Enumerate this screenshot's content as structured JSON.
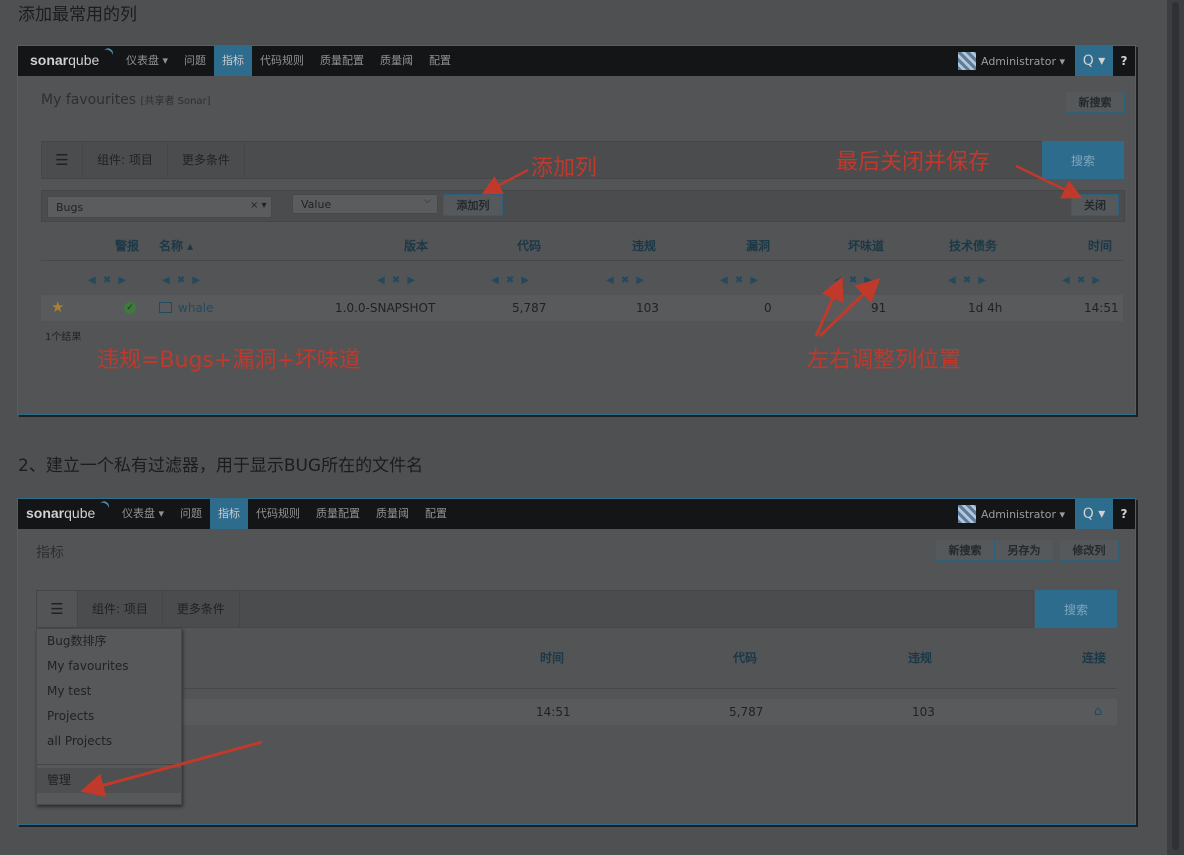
{
  "heading1": "添加最常用的列",
  "heading2": "2、建立一个私有过滤器，用于显示BUG所在的文件名",
  "navbar": {
    "logo_bold": "sonar",
    "logo_light": "qube",
    "items": [
      "仪表盘 ▾",
      "问题",
      "指标",
      "代码规则",
      "质量配置",
      "质量阈",
      "配置"
    ],
    "active": "指标",
    "user": "Administrator ▾",
    "search_icon": "Q ▾",
    "help_icon": "?"
  },
  "shot1": {
    "title": "My favourites",
    "title_sub": "[共享者 Sonar]",
    "new_search": "新搜索",
    "filter_tabs": [
      "组件: 项目",
      "更多条件"
    ],
    "search_button": "搜索",
    "bugs_input": "Bugs",
    "clear": "× ▾",
    "value_select": "Value",
    "add_column": "添加列",
    "close": "关闭",
    "columns": [
      "警报",
      "名称 ▴",
      "版本",
      "代码",
      "违规",
      "漏洞",
      "坏味道",
      "技术债务",
      "时间"
    ],
    "row": {
      "name": "whale",
      "version": "1.0.0-SNAPSHOT",
      "code": "5,787",
      "violations": "103",
      "vulnerabilities": "0",
      "smells": "91",
      "debt": "1d 4h",
      "time": "14:51"
    },
    "results": "1个结果",
    "notes": {
      "add": "添加列",
      "close_save": "最后关闭并保存",
      "violations": "违规=Bugs+漏洞+坏味道",
      "reorder": "左右调整列位置"
    }
  },
  "shot2": {
    "title": "指标",
    "buttons": [
      "新搜索",
      "另存为",
      "修改列"
    ],
    "filter_tabs": [
      "组件: 项目",
      "更多条件"
    ],
    "search_button": "搜索",
    "columns": [
      "时间",
      "代码",
      "违规",
      "连接"
    ],
    "row": {
      "time": "14:51",
      "code": "5,787",
      "violations": "103",
      "link_icon": "home-icon"
    },
    "menu": [
      "Bug数排序",
      "My favourites",
      "My test",
      "Projects",
      "all Projects"
    ],
    "manage": "管理"
  },
  "colors": {
    "annotation": "#c0392b",
    "accent": "#2e6c8d"
  }
}
